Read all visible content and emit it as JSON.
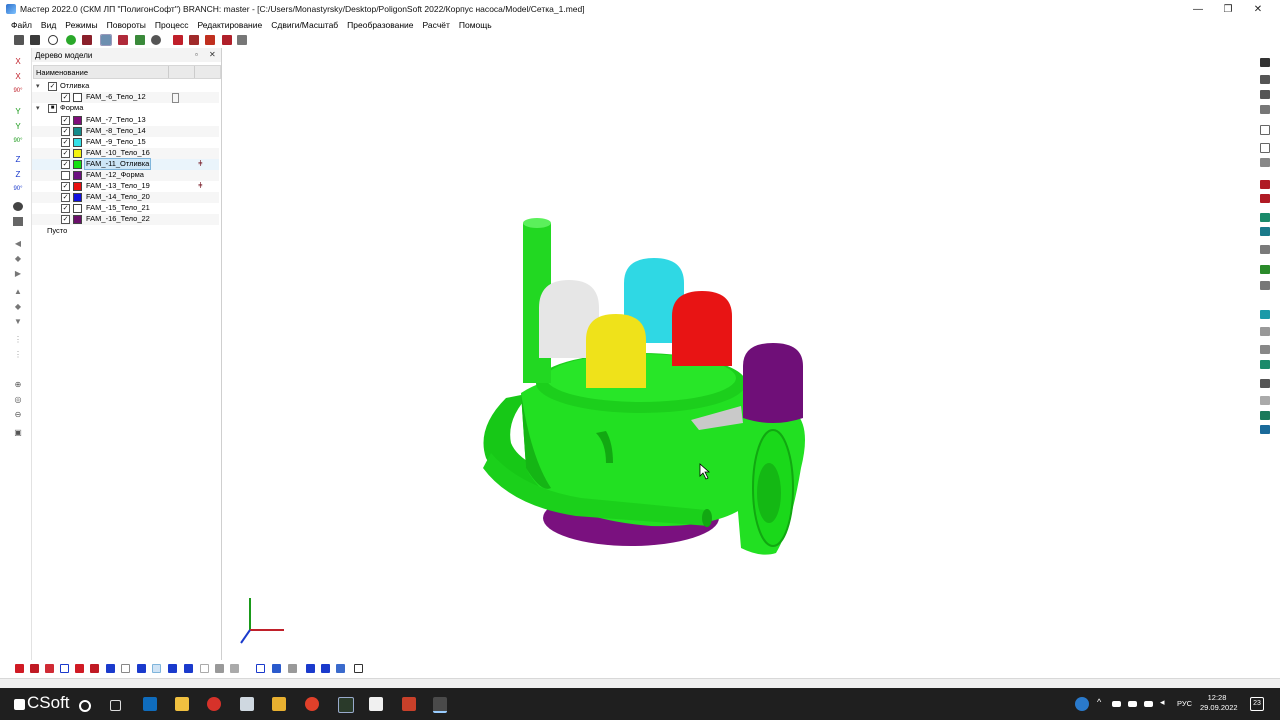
{
  "window": {
    "title": "Мастер 2022.0 (СКМ ЛП \"ПолигонСофт\") BRANCH: master - [C:/Users/Monastyrsky/Desktop/PoligonSoft 2022/Корпус насоса/Model/Сетка_1.med]",
    "minimize": "—",
    "maximize": "❐",
    "close": "✕"
  },
  "menu": [
    "Файл",
    "Вид",
    "Режимы",
    "Повороты",
    "Процесс",
    "Редактирование",
    "Сдвиги/Масштаб",
    "Преобразование",
    "Расчёт",
    "Помощь"
  ],
  "panel": {
    "title": "Дерево модели",
    "column_header": "Наименование",
    "float_btn": "▫",
    "close_btn": "✕"
  },
  "tree": {
    "group1": {
      "label": "Отливка"
    },
    "group1_items": [
      {
        "label": "FAM_-6_Тело_12",
        "color": "#ffffff",
        "checked": "✓"
      }
    ],
    "group2": {
      "label": "Форма"
    },
    "group2_items": [
      {
        "label": "FAM_-7_Тело_13",
        "color": "#800d7a",
        "checked": "✓"
      },
      {
        "label": "FAM_-8_Тело_14",
        "color": "#138a8a",
        "checked": "✓"
      },
      {
        "label": "FAM_-9_Тело_15",
        "color": "#33e0e8",
        "checked": "✓"
      },
      {
        "label": "FAM_-10_Тело_16",
        "color": "#f2f20f",
        "checked": "✓"
      },
      {
        "label": "FAM_-11_Отливка",
        "color": "#12e012",
        "checked": "✓"
      },
      {
        "label": "FAM_-12_Форма",
        "color": "#6c1080",
        "checked": ""
      },
      {
        "label": "FAM_-13_Тело_19",
        "color": "#e81010",
        "checked": "✓"
      },
      {
        "label": "FAM_-14_Тело_20",
        "color": "#1010e0",
        "checked": "✓"
      },
      {
        "label": "FAM_-15_Тело_21",
        "color": "#ffffff",
        "checked": "✓"
      },
      {
        "label": "FAM_-16_Тело_22",
        "color": "#6a0f6a",
        "checked": "✓"
      }
    ],
    "empty_label": "Пусто"
  },
  "taskbar": {
    "brand": "CSoft",
    "language": "РУС",
    "time": "12:28",
    "date": "29.09.2022",
    "notification_count": "23"
  },
  "colors": {
    "body_green": "#22e022",
    "white_riser": "#e8e8e8",
    "yellow_riser": "#efe21a",
    "cyan_riser": "#2fd8e4",
    "red_riser": "#e81414",
    "purple_riser": "#6f0f78",
    "bottom_purple": "#7a117f"
  }
}
